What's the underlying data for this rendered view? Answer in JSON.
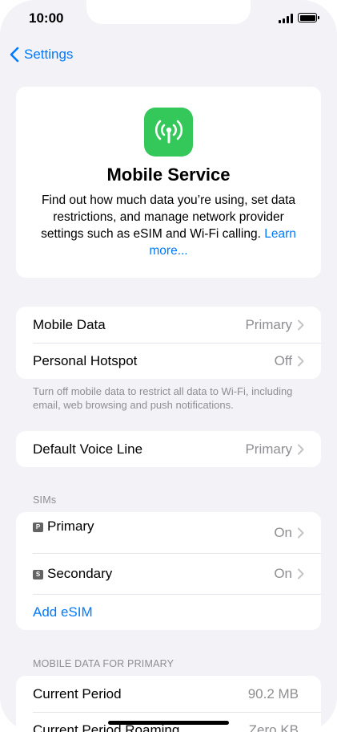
{
  "status": {
    "time": "10:00"
  },
  "nav": {
    "back_label": "Settings"
  },
  "hero": {
    "icon": "antenna-radiowaves-icon",
    "icon_color": "#34c759",
    "title": "Mobile Service",
    "description": "Find out how much data you’re using, set data restrictions, and manage network provider settings such as eSIM and Wi-Fi calling.",
    "link": "Learn more..."
  },
  "data_group": {
    "rows": [
      {
        "label": "Mobile Data",
        "value": "Primary"
      },
      {
        "label": "Personal Hotspot",
        "value": "Off"
      }
    ],
    "footer": "Turn off mobile data to restrict all data to Wi-Fi, including email, web browsing and push notifications."
  },
  "voice_group": {
    "rows": [
      {
        "label": "Default Voice Line",
        "value": "Primary"
      }
    ]
  },
  "sims": {
    "header": "SIMs",
    "rows": [
      {
        "badge": "P",
        "label": "Primary",
        "value": "On"
      },
      {
        "badge": "S",
        "label": "Secondary",
        "value": "On"
      }
    ],
    "add_label": "Add eSIM"
  },
  "usage": {
    "header": "MOBILE DATA FOR PRIMARY",
    "rows": [
      {
        "label": "Current Period",
        "value": "90.2 MB"
      },
      {
        "label": "Current Period Roaming",
        "value": "Zero KB"
      }
    ]
  },
  "colors": {
    "accent": "#007aff",
    "background": "#f2f2f7",
    "secondary_text": "#8e8e93"
  }
}
